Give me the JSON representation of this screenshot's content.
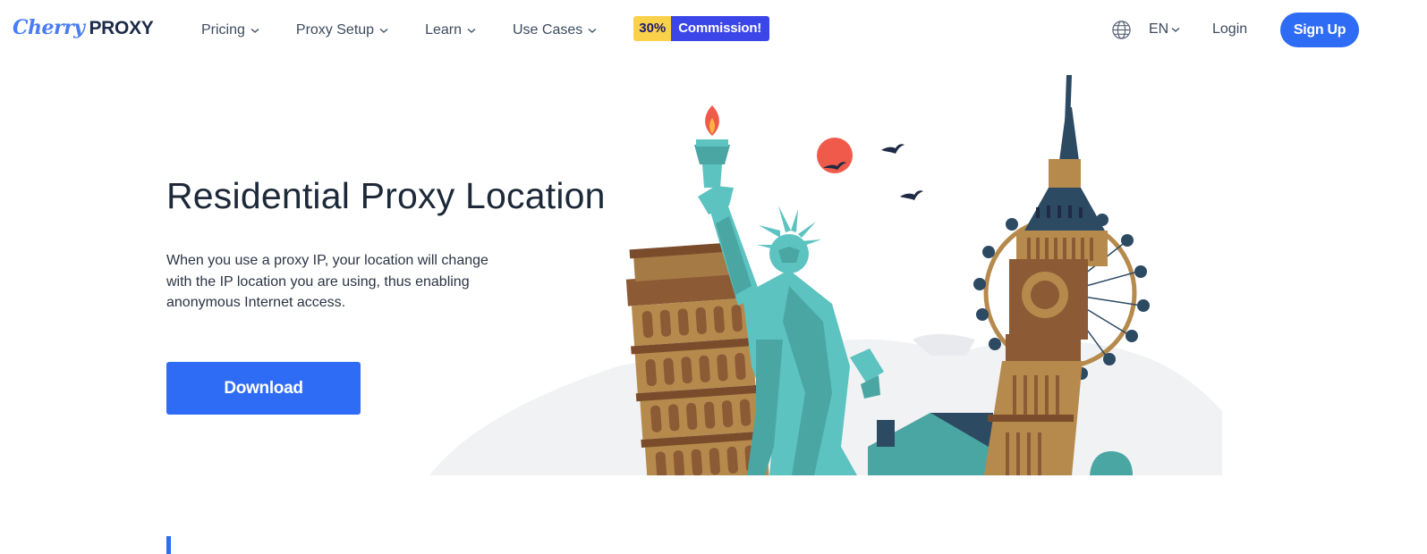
{
  "header": {
    "logo": {
      "cherry": "Cherry",
      "proxy": "PROXY"
    },
    "nav": [
      {
        "label": "Pricing"
      },
      {
        "label": "Proxy Setup"
      },
      {
        "label": "Learn"
      },
      {
        "label": "Use Cases"
      }
    ],
    "promo": {
      "percent": "30%",
      "label": "Commission!"
    },
    "language": "EN",
    "login": "Login",
    "signup": "Sign Up"
  },
  "hero": {
    "title": "Residential Proxy Location",
    "description": "When you use a proxy IP, your location will change with the IP location you are using, thus enabling anonymous Internet access.",
    "download": "Download"
  },
  "icons": {
    "nav_chevron": "chevron-down-icon",
    "language": "globe-icon"
  },
  "colors": {
    "primary": "#2f6cf6",
    "promo_yellow": "#fcd14a",
    "promo_blue": "#3b46e8",
    "heading": "#1d2939"
  }
}
